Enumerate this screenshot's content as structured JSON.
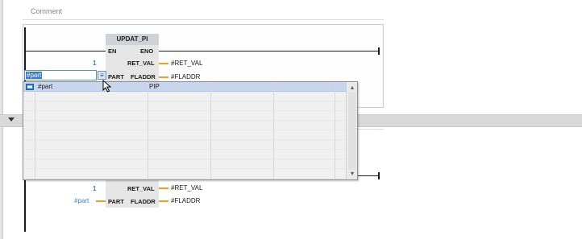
{
  "network": {
    "comment_label": "Comment",
    "block_name": "UPDAT_PI",
    "pins": {
      "en": "EN",
      "eno": "ENO",
      "ret_val": "RET_VAL",
      "part": "PART",
      "fladdr": "FLADDR"
    },
    "inputs": {
      "ret_val_index": "1"
    },
    "outputs": {
      "ret_val": "#RET_VAL",
      "fladdr": "#FLADDR"
    },
    "editor": {
      "value": "#part",
      "dropdown_icon": "list-dropdown-icon"
    }
  },
  "autocomplete": {
    "rows": [
      {
        "name": "#part",
        "type": "PIP",
        "icon": "tag-variable-icon",
        "selected": true
      },
      {
        "name": "",
        "type": "",
        "selected": false
      },
      {
        "name": "",
        "type": "",
        "selected": false
      },
      {
        "name": "",
        "type": "",
        "selected": false
      },
      {
        "name": "",
        "type": "",
        "selected": false
      },
      {
        "name": "",
        "type": "",
        "selected": false
      },
      {
        "name": "",
        "type": "",
        "selected": false
      },
      {
        "name": "",
        "type": "",
        "selected": false
      },
      {
        "name": "",
        "type": "",
        "selected": false
      },
      {
        "name": "",
        "type": "",
        "selected": false
      }
    ],
    "scroll_up_icon": "chevron-up-icon",
    "scroll_down_icon": "chevron-down-icon"
  },
  "section_divider": {
    "collapse_icon": "caret-down-icon"
  },
  "network2": {
    "ret_val_index": "1",
    "part_operand": "#part",
    "pins": {
      "ret_val": "RET_VAL",
      "part": "PART",
      "fladdr": "FLADDR"
    },
    "outputs": {
      "ret_val": "#RET_VAL",
      "fladdr": "#FLADDR"
    }
  },
  "colors": {
    "accent_blue": "#2f86d6",
    "wire_orange": "#f0a020",
    "selection": "#c7d6ec",
    "block_header": "#cfd2d6"
  }
}
